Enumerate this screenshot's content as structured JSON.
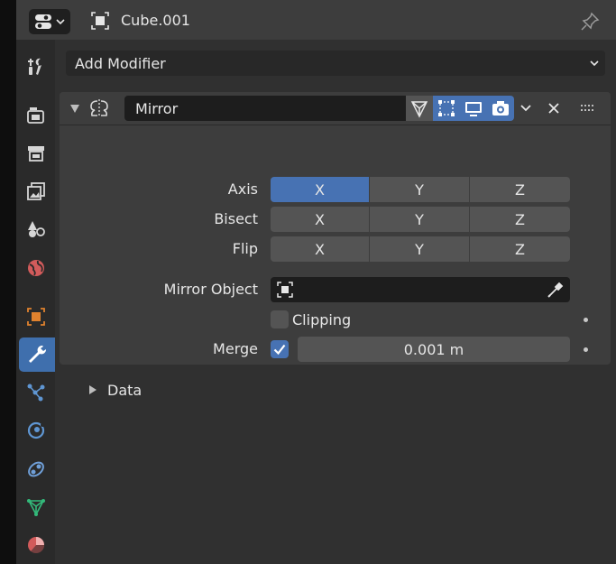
{
  "header": {
    "object_name": "Cube.001"
  },
  "add_modifier_label": "Add Modifier",
  "modifier": {
    "name": "Mirror",
    "axis_label": "Axis",
    "bisect_label": "Bisect",
    "flip_label": "Flip",
    "axes": [
      "X",
      "Y",
      "Z"
    ],
    "axis_active": "X",
    "mirror_object_label": "Mirror Object",
    "clipping_label": "Clipping",
    "clipping_checked": false,
    "merge_label": "Merge",
    "merge_checked": true,
    "merge_value": "0.001 m",
    "data_label": "Data"
  },
  "colors": {
    "accent": "#4772b3",
    "object_icon": "#e0822e",
    "tool_icon": "#d6d6d6",
    "particles": "#5f96d3",
    "constraints": "#6f9fd8",
    "data": "#33b97a",
    "material": "#d25b5b"
  },
  "tabs": [
    "tool-tab-icon",
    "render-tab-icon",
    "output-tab-icon",
    "view-layer-tab-icon",
    "scene-tab-icon",
    "world-tab-icon",
    "object-tab-icon",
    "modifier-tab-icon",
    "particles-tab-icon",
    "physics-tab-icon",
    "constraints-tab-icon",
    "data-tab-icon",
    "material-tab-icon"
  ]
}
